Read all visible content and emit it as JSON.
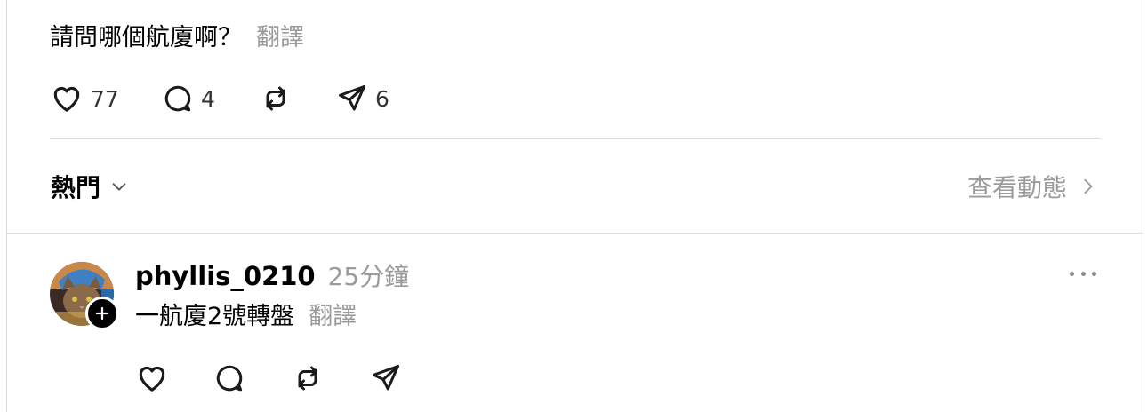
{
  "post": {
    "text": "請問哪個航廈啊？",
    "translate": "翻譯",
    "likes": "77",
    "replies": "4",
    "shares": "6"
  },
  "sort": {
    "label": "熱門"
  },
  "activity": {
    "label": "查看動態"
  },
  "reply": {
    "username": "phyllis_0210",
    "time": "25分鐘",
    "text": "一航廈2號轉盤",
    "translate": "翻譯"
  },
  "icons": [
    "heart-icon",
    "comment-icon",
    "repost-icon",
    "send-icon",
    "chevron-down-icon",
    "chevron-right-icon",
    "plus-icon",
    "more-icon"
  ]
}
